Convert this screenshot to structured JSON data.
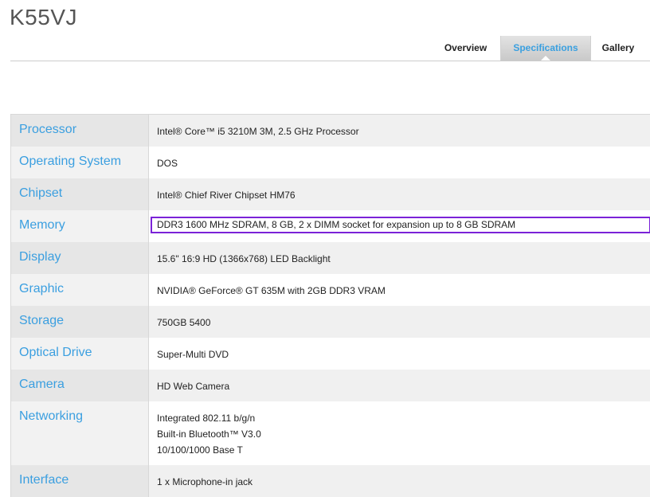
{
  "page": {
    "title": "K55VJ"
  },
  "tabs": [
    {
      "label": "Overview",
      "active": false
    },
    {
      "label": "Specifications",
      "active": true
    },
    {
      "label": "Gallery",
      "active": false
    }
  ],
  "colors": {
    "accent": "#3b9fe0",
    "highlight_border": "#7b22d8"
  },
  "specs": [
    {
      "label": "Processor",
      "value": [
        "Intel® Core™ i5 3210M 3M, 2.5 GHz Processor"
      ]
    },
    {
      "label": "Operating System",
      "value": [
        "DOS"
      ]
    },
    {
      "label": "Chipset",
      "value": [
        "Intel® Chief River Chipset HM76"
      ]
    },
    {
      "label": "Memory",
      "value": [
        "DDR3 1600 MHz SDRAM, 8 GB, 2 x DIMM socket for expansion up to 8 GB SDRAM"
      ],
      "highlighted": true
    },
    {
      "label": "Display",
      "value": [
        "15.6\" 16:9 HD (1366x768) LED Backlight"
      ]
    },
    {
      "label": "Graphic",
      "value": [
        "NVIDIA® GeForce® GT 635M with 2GB DDR3 VRAM"
      ]
    },
    {
      "label": "Storage",
      "value": [
        "750GB 5400"
      ]
    },
    {
      "label": "Optical Drive",
      "value": [
        "Super-Multi DVD"
      ]
    },
    {
      "label": "Camera",
      "value": [
        "HD Web Camera"
      ]
    },
    {
      "label": "Networking",
      "value": [
        "Integrated 802.11 b/g/n",
        "Built-in Bluetooth™ V3.0",
        "10/100/1000 Base T"
      ]
    },
    {
      "label": "Interface",
      "value": [
        "1 x Microphone-in jack"
      ]
    }
  ]
}
